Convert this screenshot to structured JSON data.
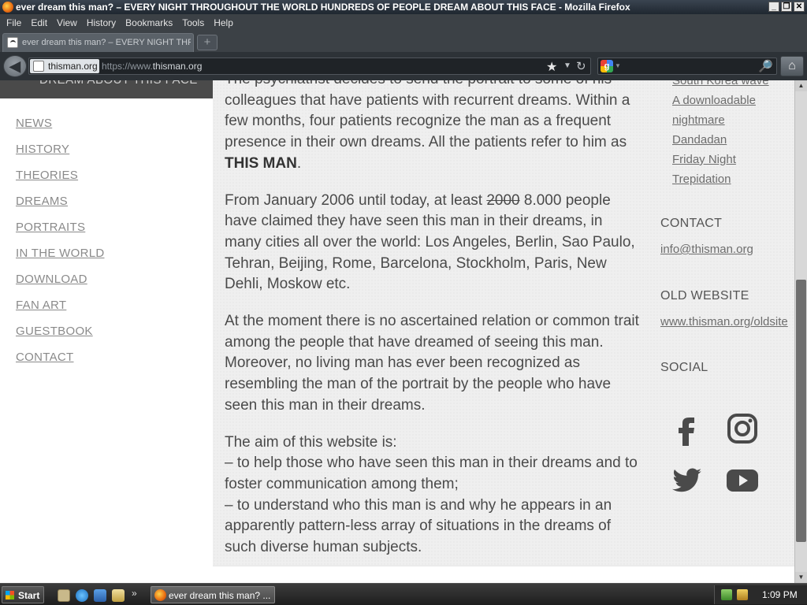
{
  "window": {
    "title": "ever dream this man? – EVERY NIGHT THROUGHOUT THE WORLD HUNDREDS OF PEOPLE DREAM ABOUT THIS FACE - Mozilla Firefox",
    "min": "_",
    "max": "❐",
    "close": "✕"
  },
  "menu": [
    "File",
    "Edit",
    "View",
    "History",
    "Bookmarks",
    "Tools",
    "Help"
  ],
  "tab": {
    "title": "ever dream this man? – EVERY NIGHT THRO...",
    "new_tab": "+"
  },
  "navbar": {
    "back": "◀",
    "identity": "thisman.org",
    "url_prefix": "https://www.",
    "url_host": "thisman.org",
    "star": "★",
    "dropdown": "▼",
    "reload": "↻",
    "search_engine_icon": "google-icon",
    "search_dropdown": "▼",
    "search_placeholder": "",
    "search_button": "🔎",
    "home": "⌂"
  },
  "site": {
    "header_tagline": "DREAM ABOUT THIS FACE",
    "nav": [
      "NEWS",
      "HISTORY",
      "THEORIES",
      "DREAMS",
      "PORTRAITS",
      "IN THE WORLD",
      "DOWNLOAD",
      "FAN ART",
      "GUESTBOOK",
      "CONTACT"
    ]
  },
  "article": {
    "p1_text": "The psychiatrist decides to send the portrait to some of his colleagues that have patients with recurrent dreams. Within a few months, four patients recognize the man as a frequent presence in their own dreams. All the patients refer to him as ",
    "p1_bold": "THIS MAN",
    "p1_end": ".",
    "p2_start": "From January 2006 until today, at least ",
    "p2_strike": "2000",
    "p2_rest": " 8.000 people have claimed they have seen this man in their dreams, in many cities all over the world: Los Angeles, Berlin, Sao Paulo, Tehran, Beijing, Rome, Barcelona, Stockholm, Paris, New Dehli, Moskow etc.",
    "p3": "At the moment there is no ascertained relation or common trait among the people that have dreamed of seeing this man. Moreover, no living man has ever been recognized as resembling the man of the portrait by the people who have seen this man in their dreams.",
    "p4_intro": "The aim of this website is:",
    "p4_line1": "– to help those who have seen this man in their dreams and to foster communication among them;",
    "p4_line2": "– to understand who this man is and why he appears in an apparently pattern-less array of situations in the dreams of such diverse human subjects."
  },
  "sidebar": {
    "links": [
      "South Korea wave",
      "A downloadable nightmare",
      "Dandadan",
      "Friday Night Trepidation"
    ],
    "contact_heading": "CONTACT",
    "contact_email": "info@thisman.org",
    "old_heading": "OLD WEBSITE",
    "old_link": "www.thisman.org/oldsite",
    "social_heading": "SOCIAL",
    "social_icons": [
      "facebook-icon",
      "instagram-icon",
      "twitter-icon",
      "youtube-icon"
    ],
    "icon_color": "#4a4a4a"
  },
  "taskbar": {
    "start": "Start",
    "chevron": "»",
    "window_label": "ever dream this man? ...",
    "clock": "1:09 PM"
  }
}
